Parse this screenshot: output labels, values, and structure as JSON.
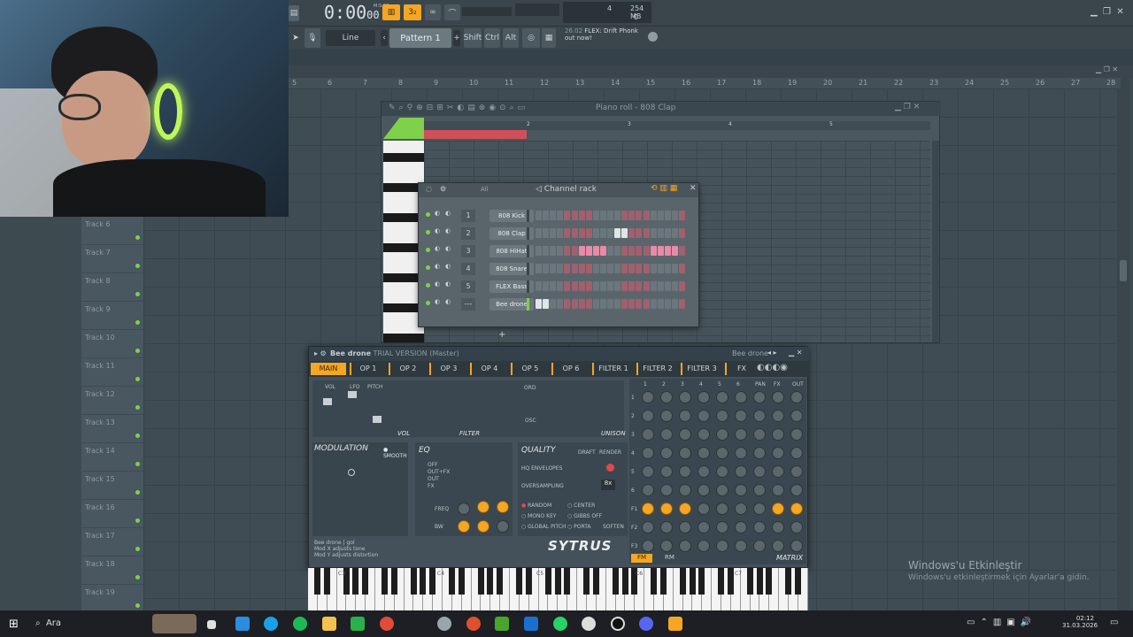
{
  "topbar": {
    "time": "0:00",
    "time_sub": "00",
    "bst": "M:S:CS",
    "mem": "254 MB",
    "cpu": "4",
    "poly": "0",
    "snap": "Line",
    "pattern": "Pattern 1",
    "shift": "Shift",
    "ctrl": "Ctrl",
    "alt": "Alt",
    "news_time": "26.02",
    "news_text": "FLEX: Drift Phonk",
    "news_text2": "out now!"
  },
  "ruler": [
    "5",
    "6",
    "7",
    "8",
    "9",
    "10",
    "11",
    "12",
    "13",
    "14",
    "15",
    "16",
    "17",
    "18",
    "19",
    "20",
    "21",
    "22",
    "23",
    "24",
    "25",
    "26",
    "27",
    "28"
  ],
  "tracks": [
    "Track 6",
    "Track 7",
    "Track 8",
    "Track 9",
    "Track 10",
    "Track 11",
    "Track 12",
    "Track 13",
    "Track 14",
    "Track 15",
    "Track 16",
    "Track 17",
    "Track 18",
    "Track 19"
  ],
  "pianoroll": {
    "title": "Piano roll - 808 Clap",
    "bars": [
      "2",
      "3",
      "4",
      "5"
    ]
  },
  "rack": {
    "title": "Channel rack",
    "filter": "All",
    "channels": [
      {
        "num": "1",
        "name": "808 Kick"
      },
      {
        "num": "2",
        "name": "808 Clap"
      },
      {
        "num": "3",
        "name": "808 HiHat"
      },
      {
        "num": "4",
        "name": "808 Snare"
      },
      {
        "num": "5",
        "name": "FLEX Bass"
      },
      {
        "num": "---",
        "name": "Bee drone"
      }
    ]
  },
  "sytrus": {
    "title": "Bee drone",
    "title_sub": "TRIAL VERSION (Master)",
    "preset": "Bee drone",
    "tabs": [
      "MAIN",
      "OP 1",
      "OP 2",
      "OP 3",
      "OP 4",
      "OP 5",
      "OP 6",
      "FILTER 1",
      "FILTER 2",
      "FILTER 3",
      "FX"
    ],
    "vol": "VOL",
    "lfo": "LFO",
    "pitch": "PITCH",
    "vol_section": "VOL",
    "filter_section": "FILTER",
    "unison": "UNISON",
    "ord": "ORD",
    "osc": "OSC",
    "modulation": "MODULATION",
    "smooth": "SMOOTH",
    "eq": "EQ",
    "quality": "QUALITY",
    "draft": "DRAFT",
    "render": "RENDER",
    "hq_env": "HQ ENVELOPES",
    "oversampling": "OVERSAMPLING",
    "os_value": "8x",
    "freq": "FREQ",
    "bw": "BW",
    "random": "RANDOM",
    "center": "CENTER",
    "monokey": "MONO KEY",
    "gibbs": "GIBBS OFF",
    "globalpitch": "GLOBAL PITCH",
    "porta": "PORTA",
    "soften": "SOFTEN",
    "info1": "Bee drone    | gol",
    "info2": "Mod X adjusts tone",
    "info3": "Mod Y adjusts distortion",
    "logo": "SYTRUS",
    "fm": "FM",
    "rm": "RM",
    "matrix": "MATRIX",
    "matrix_cols": [
      "1",
      "2",
      "3",
      "4",
      "5",
      "6",
      "PAN",
      "FX",
      "OUT"
    ],
    "matrix_rows": [
      "1",
      "2",
      "3",
      "4",
      "5",
      "6",
      "F1",
      "F2",
      "F3"
    ],
    "eq_labels": [
      "OFF",
      "OUT+FX",
      "OUT",
      "FX"
    ],
    "adsr": [
      "A",
      "D",
      "S",
      "R"
    ],
    "ord_labels": [
      "PN",
      "VL",
      "PT",
      "SB",
      "PH",
      "EN"
    ]
  },
  "keyboard": {
    "labels": [
      "C3",
      "C4",
      "C5",
      "C6",
      "C7"
    ]
  },
  "watermark": {
    "line1": "Windows'u Etkinleştir",
    "line2": "Windows'u etkinleştirmek için Ayarlar'a gidin."
  },
  "taskbar": {
    "search": "Ara",
    "time": "02:12",
    "date": "31.03.2026"
  },
  "colors": {
    "accent": "#f5a623",
    "led": "#7fd04a",
    "step_pink": "#e88aa8",
    "step_on": "#dfe6e8"
  }
}
